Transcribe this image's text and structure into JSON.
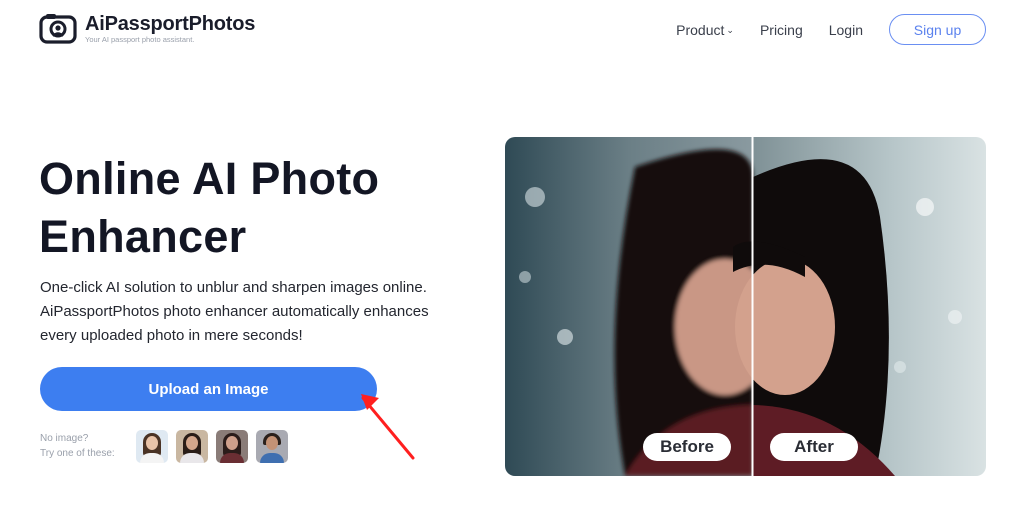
{
  "header": {
    "logo": {
      "name": "AiPassportPhotos",
      "tagline": "Your AI passport photo assistant.",
      "icon": "camera-icon"
    },
    "nav": [
      {
        "label": "Product",
        "icon": "chevron-down-icon"
      },
      {
        "label": "Pricing"
      },
      {
        "label": "Login"
      }
    ],
    "signup_label": "Sign up"
  },
  "hero": {
    "title_line1": "Online AI Photo",
    "title_line2": "Enhancer",
    "description": [
      "One-click AI solution to unblur and sharpen images online.",
      "AiPassportPhotos photo enhancer automatically enhances",
      "every uploaded photo in mere seconds!"
    ],
    "upload_label": "Upload an Image",
    "samples_label_line1": "No image?",
    "samples_label_line2": "Try one of these:",
    "samples": [
      {
        "name": "sample-girl-short-hair"
      },
      {
        "name": "sample-woman-long-hair"
      },
      {
        "name": "sample-woman-dark-hair"
      },
      {
        "name": "sample-man-smiling"
      }
    ]
  },
  "comparison": {
    "before_label": "Before",
    "after_label": "After"
  },
  "colors": {
    "accent": "#3d7ef0",
    "signup_border": "#6a8ff2",
    "annotation_arrow": "#ff1f1f"
  }
}
